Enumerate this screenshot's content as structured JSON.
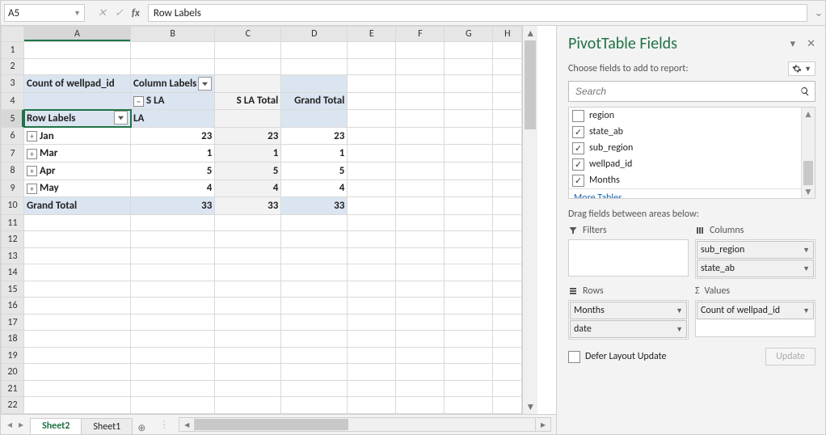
{
  "formula_bar": {
    "cell_ref": "A5",
    "fx_label": "fx",
    "content": "Row Labels"
  },
  "columns": [
    "A",
    "B",
    "C",
    "D",
    "E",
    "F",
    "G",
    "H"
  ],
  "row_numbers": [
    1,
    2,
    3,
    4,
    5,
    6,
    7,
    8,
    9,
    10,
    11,
    12,
    13,
    14,
    15,
    16,
    17,
    18,
    19,
    20,
    21,
    22
  ],
  "pivot": {
    "a3": "Count of wellpad_id",
    "b3": "Column Labels",
    "b4": "S LA",
    "c4": "S LA Total",
    "d4": "Grand Total",
    "a5": "Row Labels",
    "b5": "LA",
    "rows": [
      {
        "label": "Jan",
        "b": "23",
        "c": "23",
        "d": "23"
      },
      {
        "label": "Mar",
        "b": "1",
        "c": "1",
        "d": "1"
      },
      {
        "label": "Apr",
        "b": "5",
        "c": "5",
        "d": "5"
      },
      {
        "label": "May",
        "b": "4",
        "c": "4",
        "d": "4"
      }
    ],
    "grand_label": "Grand Total",
    "grand": {
      "b": "33",
      "c": "33",
      "d": "33"
    }
  },
  "tabs": {
    "active": "Sheet2",
    "other": "Sheet1"
  },
  "pane": {
    "title": "PivotTable Fields",
    "hint": "Choose fields to add to report:",
    "search_placeholder": "Search",
    "fields": [
      {
        "label": "region",
        "checked": false
      },
      {
        "label": "state_ab",
        "checked": true
      },
      {
        "label": "sub_region",
        "checked": true
      },
      {
        "label": "wellpad_id",
        "checked": true
      },
      {
        "label": "Months",
        "checked": true
      }
    ],
    "more": "More Tables...",
    "drag_hint": "Drag fields between areas below:",
    "areas": {
      "filters": {
        "title": "Filters",
        "items": []
      },
      "columns": {
        "title": "Columns",
        "items": [
          "sub_region",
          "state_ab"
        ]
      },
      "rows": {
        "title": "Rows",
        "items": [
          "Months",
          "date"
        ]
      },
      "values": {
        "title": "Values",
        "items": [
          "Count of wellpad_id"
        ]
      }
    },
    "defer": "Defer Layout Update",
    "update": "Update"
  }
}
